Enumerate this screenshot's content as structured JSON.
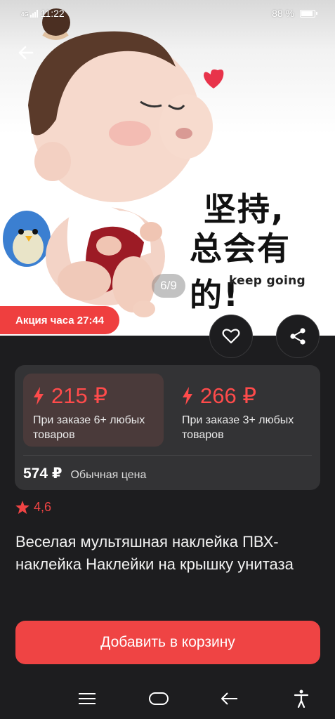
{
  "status_bar": {
    "time": "11:22",
    "network": "4G",
    "battery_percent": "88 %",
    "battery_level": 0.88
  },
  "gallery": {
    "pager": "6/9",
    "image_text_line1": "坚持,",
    "image_text_line2": "总会有的!",
    "image_text_en": "keep going"
  },
  "promo": {
    "badge": "Акция часа 27:44"
  },
  "price_tiers": [
    {
      "price": "215 ₽",
      "note": "При заказе 6+ любых товаров"
    },
    {
      "price": "266 ₽",
      "note": "При заказе 3+ любых товаров"
    }
  ],
  "regular": {
    "price": "574 ₽",
    "label": "Обычная цена"
  },
  "rating": "4,6",
  "product_title": "Веселая мультяшная наклейка ПВХ-наклейка Наклейки на крышку унитаза",
  "cart_button": "Добавить в корзину",
  "colors": {
    "accent": "#ef4444",
    "background": "#1d1d1f",
    "card": "#333335"
  },
  "icons": [
    "back-arrow-icon",
    "heart-icon",
    "share-icon",
    "lightning-icon",
    "star-icon",
    "menu-icon",
    "home-icon",
    "back-icon",
    "accessibility-icon"
  ]
}
